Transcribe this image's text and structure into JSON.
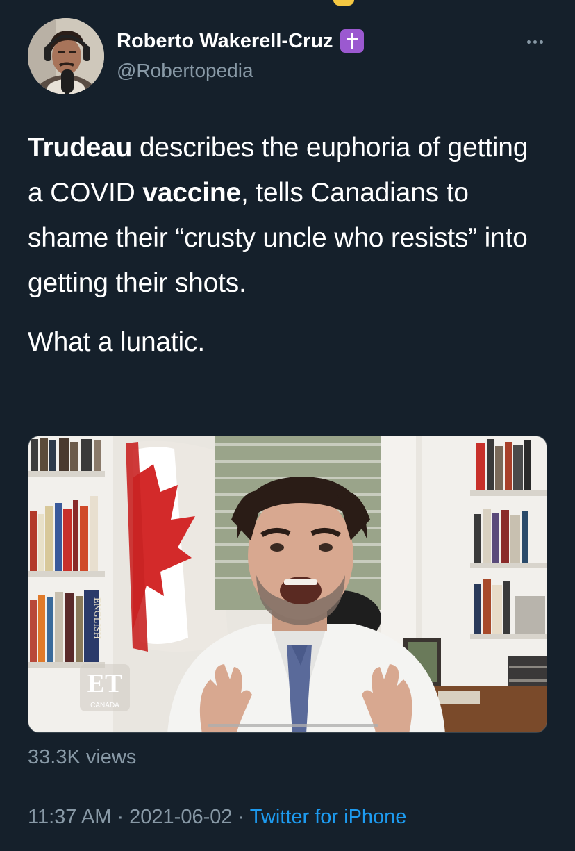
{
  "author": {
    "display_name": "Roberto Wakerell-Cruz",
    "handle": "@Robertopedia",
    "badge_icon": "latin-cross-icon",
    "badge_color": "#9b59d0"
  },
  "more_icon": "more-horizontal-icon",
  "tweet": {
    "p1_bold1": "Trudeau",
    "p1_text1": " describes the euphoria of getting a COVID ",
    "p1_bold2": "vaccine",
    "p1_text2": ", tells Canadians to shame their “crusty uncle who resists” into getting their shots.",
    "p2": "What a lunatic."
  },
  "media": {
    "watermark_main": "ET",
    "watermark_sub": "CANADA",
    "book_spine_text": "ENGLISH"
  },
  "stats": {
    "views": "33.3K views"
  },
  "meta": {
    "time": "11:37 AM",
    "sep1": " · ",
    "date": "2021-06-02",
    "sep2": " · ",
    "source": "Twitter for iPhone"
  },
  "colors": {
    "background": "#15202b",
    "secondary_text": "#8899a6",
    "link": "#1d9bf0"
  }
}
